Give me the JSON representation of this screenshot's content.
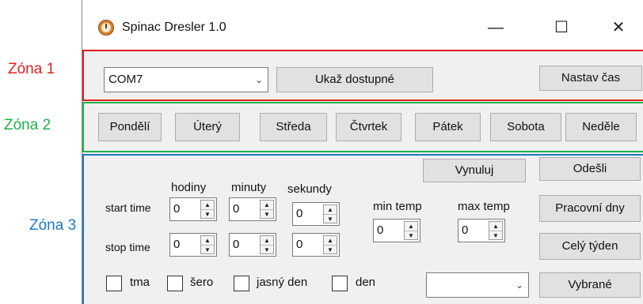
{
  "labels": {
    "zone1": "Zóna 1",
    "zone2": "Zóna 2",
    "zone3": "Zóna 3"
  },
  "colors": {
    "zone1": "#e02020",
    "zone2": "#22b04c",
    "zone3": "#1f77c4"
  },
  "window": {
    "title": "Spinac Dresler 1.0",
    "icon": "clock-icon",
    "minimize": "—",
    "maximize": "☐",
    "close": "✕"
  },
  "zone1": {
    "port_value": "COM7",
    "show_available": "Ukaž dostupné",
    "set_time": "Nastav čas"
  },
  "zone2": {
    "days": [
      "Pondělí",
      "Úterý",
      "Středa",
      "Čtvrtek",
      "Pátek",
      "Sobota",
      "Neděle"
    ]
  },
  "zone3": {
    "reset": "Vynuluj",
    "send": "Odešli",
    "headers": {
      "hours": "hodiny",
      "minutes": "minuty",
      "seconds": "sekundy"
    },
    "start_label": "start time",
    "stop_label": "stop time",
    "start": {
      "h": "0",
      "m": "0",
      "s": "0"
    },
    "stop": {
      "h": "0",
      "m": "0",
      "s": "0"
    },
    "min_temp_label": "min temp",
    "max_temp_label": "max temp",
    "min_temp": "0",
    "max_temp": "0",
    "workdays": "Pracovní dny",
    "whole_week": "Celý týden",
    "selected": "Vybrané",
    "select_value": "",
    "checkboxes": [
      "tma",
      "šero",
      "jasný den",
      "den"
    ]
  }
}
